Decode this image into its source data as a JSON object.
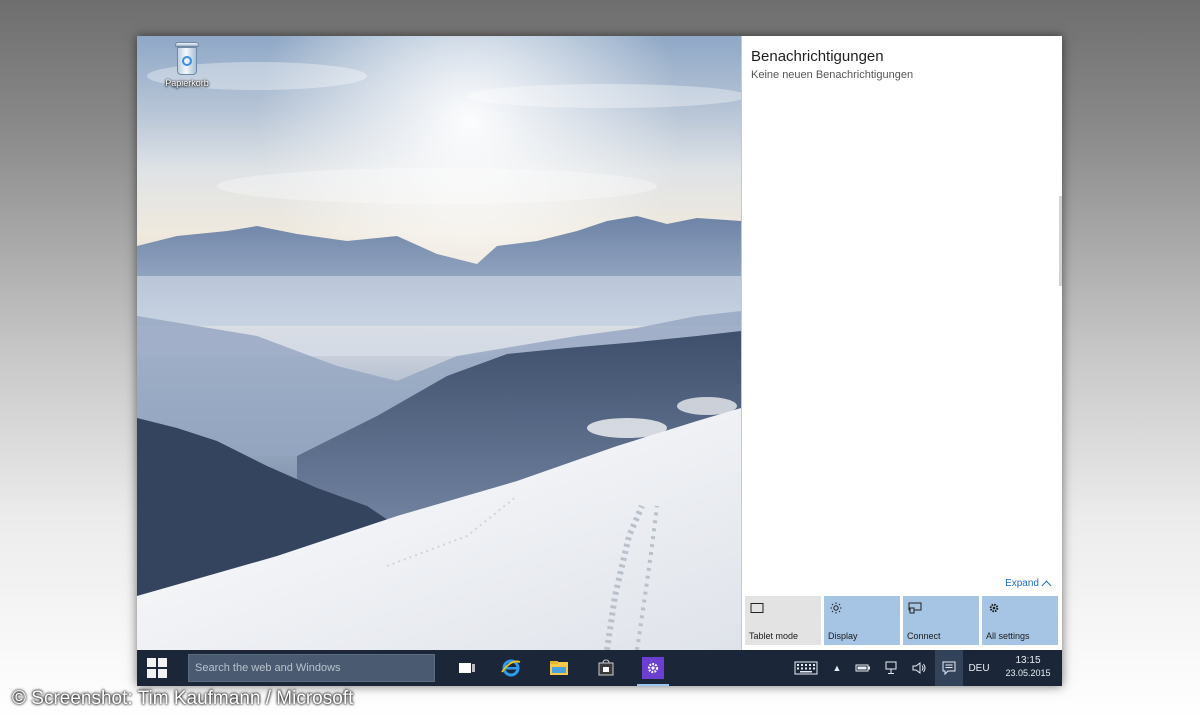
{
  "desktop": {
    "icons": [
      {
        "label": "Papierkorb",
        "icon": "recycle-bin-icon"
      }
    ]
  },
  "action_center": {
    "title": "Benachrichtigungen",
    "subtitle": "Keine neuen Benachrichtigungen",
    "expand_label": "Expand",
    "quick_actions": [
      {
        "label": "Tablet mode",
        "icon": "tablet-mode-icon",
        "active": false
      },
      {
        "label": "Display",
        "icon": "brightness-icon",
        "active": true
      },
      {
        "label": "Connect",
        "icon": "connect-icon",
        "active": true
      },
      {
        "label": "All settings",
        "icon": "gear-icon",
        "active": true
      }
    ]
  },
  "taskbar": {
    "search_placeholder": "Search the web and Windows",
    "apps": [
      {
        "name": "Task View",
        "icon": "task-view-icon"
      },
      {
        "name": "Internet Explorer",
        "icon": "internet-explorer-icon"
      },
      {
        "name": "File Explorer",
        "icon": "file-explorer-icon"
      },
      {
        "name": "Store",
        "icon": "store-icon"
      },
      {
        "name": "Settings",
        "icon": "settings-icon",
        "active": true
      }
    ],
    "tray": {
      "language": "DEU",
      "time": "13:15",
      "date": "23.05.2015"
    }
  },
  "credit": "© Screenshot: Tim Kaufmann / Microsoft",
  "colors": {
    "taskbar": "#1b2738",
    "tile_active": "#a6c4e3",
    "tile_inactive": "#e3e3e3",
    "link": "#1e6fd0"
  }
}
